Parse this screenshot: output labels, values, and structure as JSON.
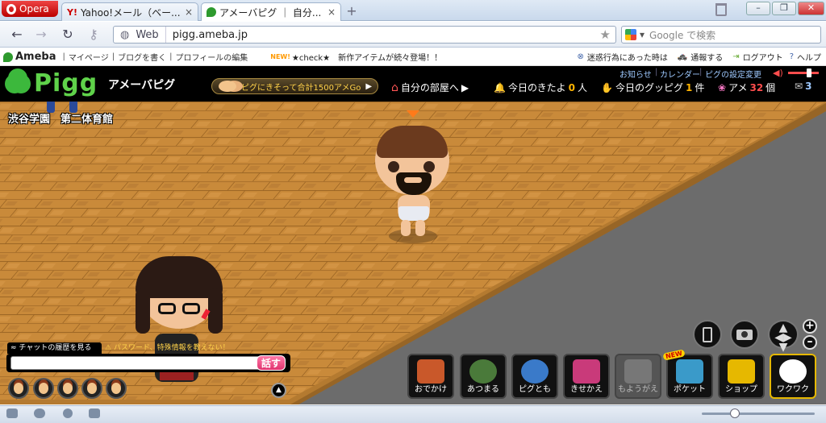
{
  "browser": {
    "opera_label": "Opera",
    "tabs": [
      {
        "title": "Yahoo!メール（ベー...",
        "close": "×"
      },
      {
        "title": "アメーバピグ ｜ 自分...",
        "close": "×"
      }
    ],
    "new_tab": "+",
    "address": {
      "scheme_label": "Web",
      "url": "pigg.ameba.jp"
    },
    "search_placeholder": "Google で検索"
  },
  "ameba_bar": {
    "logo": "Ameba",
    "links": [
      "マイページ",
      "ブログを書く",
      "プロフィールの編集"
    ],
    "news": "★check★　新作アイテムが続々登場！！",
    "new_badge": "NEW!",
    "right_links": [
      "迷惑行為にあった時は",
      "通報する",
      "ログアウト",
      "ヘルプ"
    ]
  },
  "pigg_header": {
    "logo": "Pigg",
    "subtitle": "アメーバピグ",
    "promo": "ピグにきそって合計1500アメGo",
    "links": [
      "お知らせ",
      "カレンダー",
      "ピグの設定変更"
    ],
    "my_room": "自分の部屋へ",
    "visitors_label": "今日のきたよ",
    "visitors_count": "0",
    "visitors_unit": "人",
    "good_pigg_label": "今日のグッピグ",
    "good_pigg_count": "1",
    "good_pigg_unit": "件",
    "ame_label": "アメ",
    "ame_count": "32",
    "ame_unit": "個",
    "mail_count": "3"
  },
  "game": {
    "room_name": "渋谷学園　第二体育館"
  },
  "chat": {
    "history_label": "チャットの履歴を見る",
    "warning": "パスワード、特殊情報を教えない！",
    "input_value": "",
    "talk_button": "話す"
  },
  "dock": [
    {
      "label": "おでかけ",
      "color": "#c9582a"
    },
    {
      "label": "あつまる",
      "color": "#4a7a3a"
    },
    {
      "label": "ピグとも",
      "color": "#3a7ac9"
    },
    {
      "label": "きせかえ",
      "color": "#c93a7a"
    },
    {
      "label": "もようがえ",
      "color": "#777777"
    },
    {
      "label": "ポケット",
      "color": "#3a9ac9"
    },
    {
      "label": "ショップ",
      "color": "#e6b800"
    },
    {
      "label": "ワクワク",
      "color": "#ffffff"
    }
  ],
  "new_badge": "NEW",
  "colors": {
    "accent": "#ffb400",
    "floor": "#c98a3a",
    "pigg_green": "#5fd24a"
  }
}
